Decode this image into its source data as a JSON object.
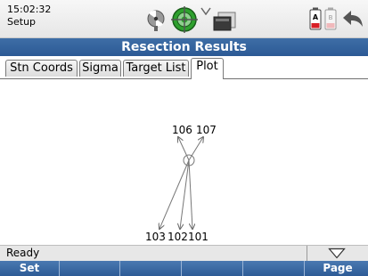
{
  "status_bar": {
    "time": "15:02:32",
    "mode": "Setup"
  },
  "icons": {
    "radio": "radio-link-icon",
    "target": "target-prism-icon",
    "signal": "tracking-signal-icon",
    "instrument": "instrument-icon",
    "battery_a": "battery-a-icon",
    "battery_b": "battery-b-icon",
    "back": "back-arrow-icon"
  },
  "title": "Resection Results",
  "tabs": [
    "Stn Coords",
    "Sigma",
    "Target List",
    "Plot"
  ],
  "active_tab": "Plot",
  "plot": {
    "labels": {
      "p106": "106",
      "p107": "107",
      "p103": "103",
      "p102": "102",
      "p101": "101"
    }
  },
  "footer": {
    "status": "Ready",
    "dropdown_icon": "triangle-down-icon"
  },
  "softkeys": [
    "Set",
    "",
    "",
    "",
    "",
    "Page"
  ],
  "colors": {
    "title_bar": "#2c5a95",
    "softkey_bar": "#2d5b96",
    "battery_low": "#d81f26"
  }
}
